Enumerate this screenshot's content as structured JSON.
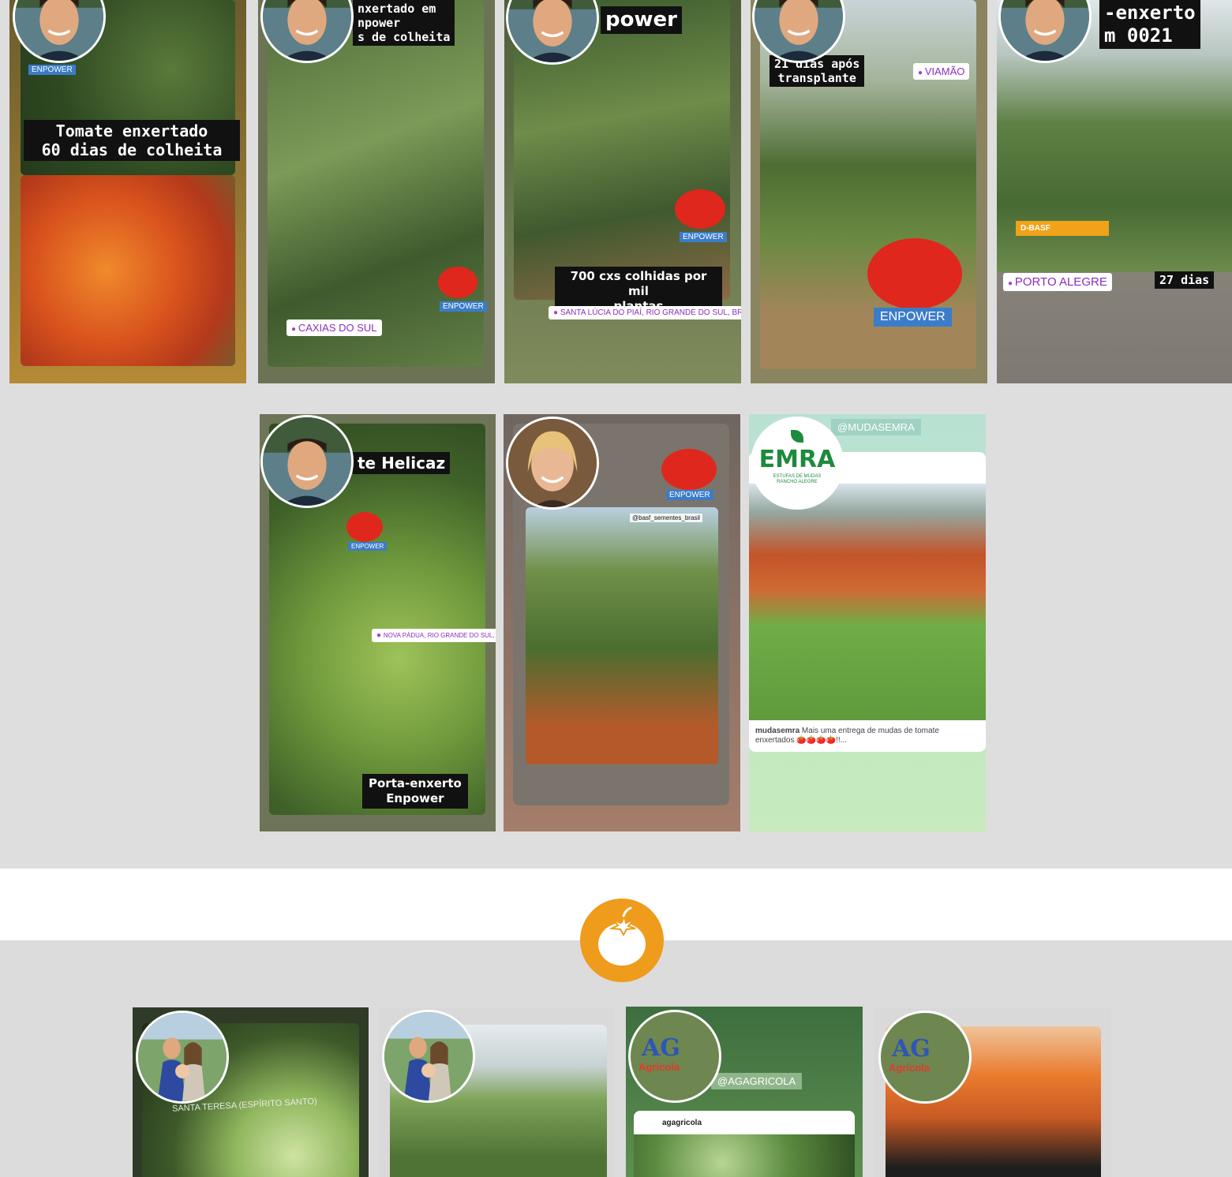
{
  "colors": {
    "accent_orange": "#ef9b1c",
    "enpower_blue": "#3b7cc9",
    "location_purple": "#8a2dbd"
  },
  "stories_row1": [
    {
      "caption": "Tomate enxertado\n60 dias de colheita",
      "badge": "ENPOWER"
    },
    {
      "caption_partial": "nxertado em\nnpower\ns de colheita",
      "location": "CAXIAS DO SUL",
      "badge": "ENPOWER"
    },
    {
      "caption_partial": "power",
      "caption2": "700 cxs colhidas por mil\nplantas",
      "location": "SANTA LÚCIA DO PIAÍ, RIO GRANDE DO SUL, BR...",
      "badge": "ENPOWER"
    },
    {
      "caption_partial": "21 dias após\ntransplante",
      "location": "VIAMÃO",
      "badge": "ENPOWER"
    },
    {
      "caption_partial": "-enxerto\nm 0021",
      "location": "PORTO ALEGRE",
      "counter": "27 dias",
      "brand": "D-BASF"
    }
  ],
  "stories_row2": [
    {
      "caption_partial": "te Helicaz",
      "location": "NOVA PÁDUA, RIO GRANDE DO SUL, BRAZIL",
      "caption2": "Porta-enxerto\nEnpower",
      "badge": "ENPOWER"
    },
    {
      "tag": "@basf_sementes_brasil",
      "badge": "ENPOWER"
    },
    {
      "handle": "@MUDASEMRA",
      "avatar_text": "EMRA",
      "avatar_subtext": "ESTUFAS DE MUDAS\nRANCHO ALEGRE",
      "post_user": "mudasemra",
      "post_text": "Mais uma entrega de mudas de tomate enxertados 🍅🍅🍅🍅!!..."
    }
  ],
  "stories_row3": [
    {
      "location": "SANTA TERESA (ESPÍRITO SANTO)"
    },
    {},
    {
      "handle": "@AGAGRICOLA",
      "post_user": "agagricola",
      "avatar_text": "AG",
      "avatar_subtext": "Agrícola"
    },
    {
      "avatar_text": "AG",
      "avatar_subtext": "Agrícola"
    }
  ]
}
